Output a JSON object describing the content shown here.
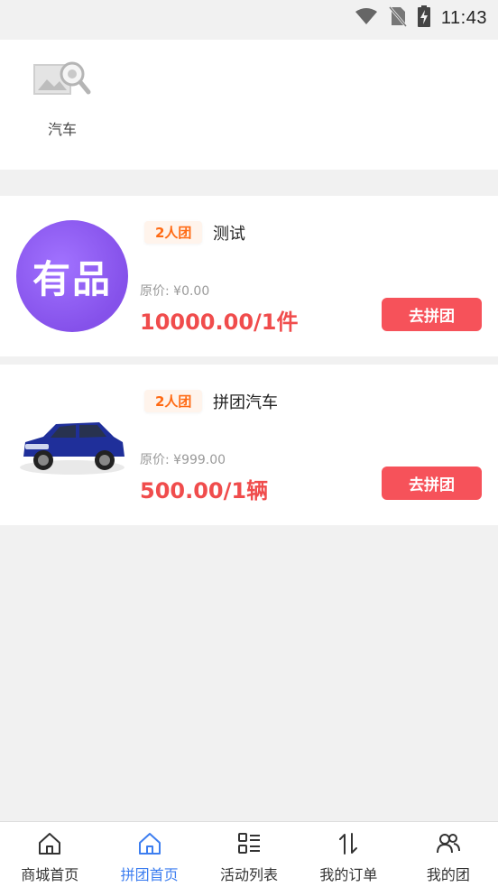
{
  "status_bar": {
    "time": "11:43",
    "icons": [
      "wifi-icon",
      "no-sim-icon",
      "battery-charging-icon"
    ]
  },
  "categories": [
    {
      "label": "汽车",
      "icon": "image-search-placeholder-icon"
    }
  ],
  "products": [
    {
      "badge": "2人团",
      "title": "测试",
      "thumbnail_text": "有品",
      "original_price": "原价: ¥0.00",
      "group_price": "10000.00/1件",
      "button_label": "去拼团"
    },
    {
      "badge": "2人团",
      "title": "拼团汽车",
      "thumbnail": "blue-suv-image",
      "original_price": "原价: ¥999.00",
      "group_price": "500.00/1辆",
      "button_label": "去拼团"
    }
  ],
  "bottom_nav": [
    {
      "label": "商城首页",
      "icon": "home-icon",
      "active": false
    },
    {
      "label": "拼团首页",
      "icon": "home-icon",
      "active": true
    },
    {
      "label": "活动列表",
      "icon": "list-icon",
      "active": false
    },
    {
      "label": "我的订单",
      "icon": "sort-arrows-icon",
      "active": false
    },
    {
      "label": "我的团",
      "icon": "group-icon",
      "active": false
    }
  ],
  "colors": {
    "accent": "#3d7ef0",
    "price": "#f04c4c",
    "button": "#f6525a",
    "badge_text": "#ff6a13",
    "badge_bg": "#fff4ec",
    "brand_purple": "#8551ea"
  }
}
